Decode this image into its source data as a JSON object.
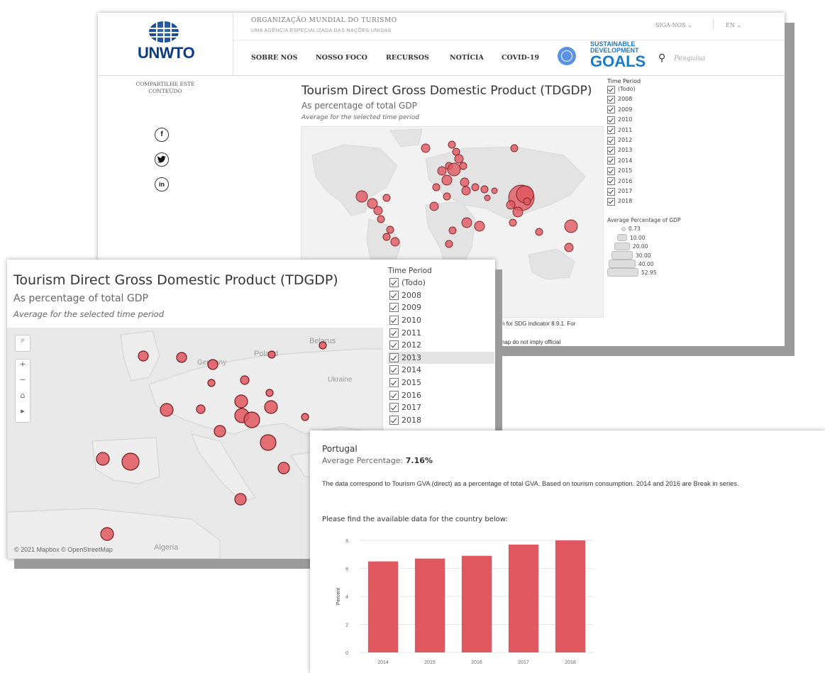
{
  "site": {
    "logo_text": "UNWTO",
    "org_name": "ORGANIZAÇÃO MUNDIAL DO TURISMO",
    "org_tagline": "UMA AGÊNCIA ESPECIALIZADA DAS NAÇÕES UNIDAS",
    "follow_label": "SIGA-NOS ⌄",
    "lang_label": "EN ⌄",
    "nav": [
      "SOBRE NÓS",
      "NOSSO FOCO",
      "RECURSOS",
      "NOTÍCIA",
      "COVID-19"
    ],
    "sdg_line1": "SUSTAINABLE",
    "sdg_line2": "DEVELOPMENT",
    "sdg_goals": "GOALS",
    "search_placeholder": "Pesquisa",
    "share_label": "COMPARTILHE ESTE CONTEÚDO",
    "social": [
      "f",
      "t",
      "in"
    ],
    "icons": {
      "search": "search-icon",
      "facebook": "facebook-icon",
      "twitter": "twitter-icon",
      "linkedin": "linkedin-icon"
    }
  },
  "dashboard": {
    "title": "Tourism Direct Gross Domestic Product (TDGDP)",
    "subtitle": "As percentage of total GDP",
    "subtitle2": "Average for the selected time period",
    "time_period_label": "Time Period",
    "time_options": [
      "(Todo)",
      "2008",
      "2009",
      "2010",
      "2011",
      "2012",
      "2013",
      "2014",
      "2015",
      "2016",
      "2017",
      "2018"
    ],
    "highlighted_option": "2013",
    "legend_title": "Average Percentage of GDP",
    "legend_values": [
      "0.73",
      "10.00",
      "20.00",
      "30.00",
      "40.00",
      "52.95"
    ],
    "footnote1": "ection for SDG indicator 8.9.1. For",
    "footnote2": "this map do not imply official",
    "map_attribution": "© 2021 Mapbox  © OpenStreetMap",
    "map_labels": {
      "poland": "Poland",
      "belarus": "Belarus",
      "germany": "Germany",
      "ukraine": "Ukraine",
      "algeria": "Algeria"
    },
    "map_tools": [
      "⌕",
      "+",
      "−",
      "⌂",
      "▸"
    ],
    "bubble_color": "#e0585f"
  },
  "tooltip": {
    "country": "Portugal",
    "avg_label": "Average Percentage:",
    "avg_value": "7.16%",
    "note": "The data correspond to Tourism GVA (direct) as a percentage of total GVA. Based on tourism consumption. 2014 and 2016 are Break in series.",
    "find_text": "Please find the available data for the country below:"
  },
  "chart_data": {
    "type": "bar",
    "categories": [
      "2014",
      "2015",
      "2016",
      "2017",
      "2018"
    ],
    "values": [
      6.5,
      6.7,
      6.9,
      7.7,
      8.0
    ],
    "ylabel": "Percent",
    "ylim": [
      0,
      8
    ],
    "yticks": [
      0,
      2,
      4,
      6,
      8
    ],
    "color": "#e0585f",
    "grid": true
  }
}
